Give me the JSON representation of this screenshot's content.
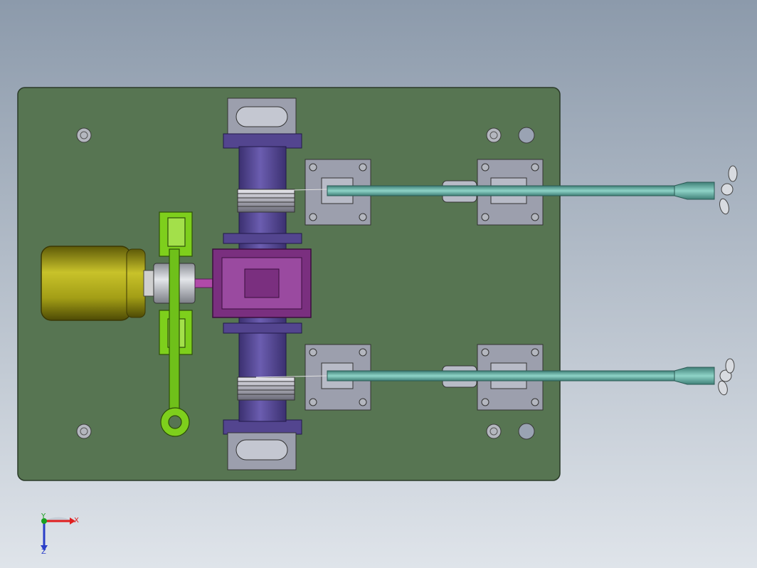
{
  "colors": {
    "background_top": "#8c9aab",
    "background_bottom": "#dfe4ea",
    "base_plate": "#577552",
    "motor": "#b0aa1a",
    "shaft": "#53458f",
    "gearbox": "#7a2f7f",
    "linkage": "#7ecf1c",
    "block": "#9c9fad",
    "rod": "#79c0b4",
    "bolt": "#b4b7bf",
    "axis_x": "#e02020",
    "axis_y": "#1aa020",
    "axis_z": "#2a3ec8"
  },
  "triad": {
    "x_label": "X",
    "y_label": "Y",
    "z_label": "Z"
  }
}
